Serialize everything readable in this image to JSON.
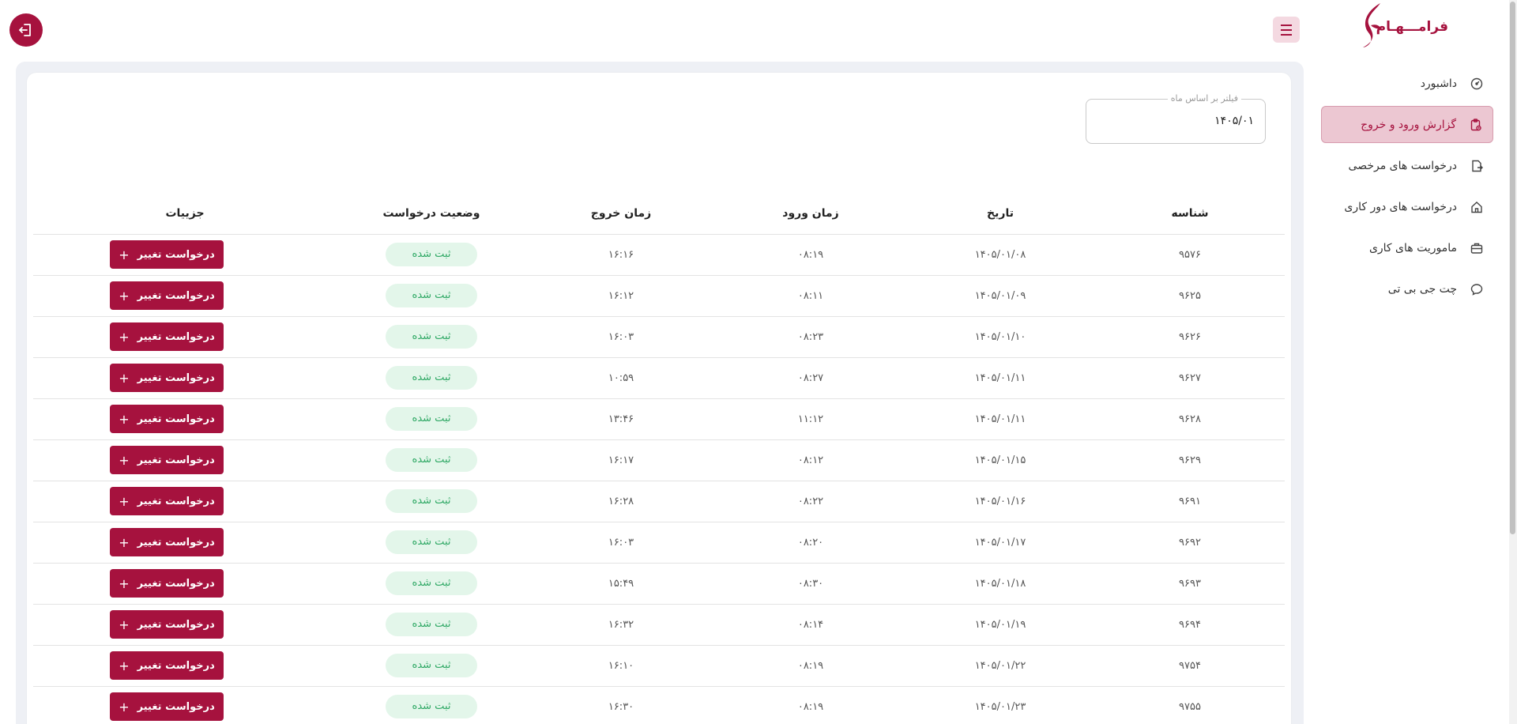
{
  "brand": {
    "logo_text": "فرامـــهـام",
    "accent": "#a6123e"
  },
  "sidebar": {
    "items": [
      {
        "label": "داشبورد",
        "icon": "dashboard-icon"
      },
      {
        "label": "گزارش ورود و خروج",
        "icon": "report-clipboard-icon",
        "active": true
      },
      {
        "label": "درخواست های مرخصی",
        "icon": "leave-request-icon"
      },
      {
        "label": "درخواست های دور کاری",
        "icon": "home-icon"
      },
      {
        "label": "ماموریت های کاری",
        "icon": "briefcase-icon"
      },
      {
        "label": "چت جی بی تی",
        "icon": "chat-icon"
      }
    ]
  },
  "filter": {
    "label": "فیلتر بر اساس ماه",
    "value": "۱۴۰۵/۰۱"
  },
  "table": {
    "headers": {
      "id": "شناسه",
      "date": "تاریخ",
      "in": "زمان ورود",
      "out": "زمان خروج",
      "status": "وضعیت درخواست",
      "details": "جزییات"
    },
    "action_label": "درخواست تغییر",
    "rows": [
      {
        "id": "۹۵۷۶",
        "date": "۱۴۰۵/۰۱/۰۸",
        "in": "۰۸:۱۹",
        "out": "۱۶:۱۶",
        "status": "ثبت شده"
      },
      {
        "id": "۹۶۲۵",
        "date": "۱۴۰۵/۰۱/۰۹",
        "in": "۰۸:۱۱",
        "out": "۱۶:۱۲",
        "status": "ثبت شده"
      },
      {
        "id": "۹۶۲۶",
        "date": "۱۴۰۵/۰۱/۱۰",
        "in": "۰۸:۲۳",
        "out": "۱۶:۰۳",
        "status": "ثبت شده"
      },
      {
        "id": "۹۶۲۷",
        "date": "۱۴۰۵/۰۱/۱۱",
        "in": "۰۸:۲۷",
        "out": "۱۰:۵۹",
        "status": "ثبت شده"
      },
      {
        "id": "۹۶۲۸",
        "date": "۱۴۰۵/۰۱/۱۱",
        "in": "۱۱:۱۲",
        "out": "۱۳:۴۶",
        "status": "ثبت شده"
      },
      {
        "id": "۹۶۲۹",
        "date": "۱۴۰۵/۰۱/۱۵",
        "in": "۰۸:۱۲",
        "out": "۱۶:۱۷",
        "status": "ثبت شده"
      },
      {
        "id": "۹۶۹۱",
        "date": "۱۴۰۵/۰۱/۱۶",
        "in": "۰۸:۲۲",
        "out": "۱۶:۲۸",
        "status": "ثبت شده"
      },
      {
        "id": "۹۶۹۲",
        "date": "۱۴۰۵/۰۱/۱۷",
        "in": "۰۸:۲۰",
        "out": "۱۶:۰۳",
        "status": "ثبت شده"
      },
      {
        "id": "۹۶۹۳",
        "date": "۱۴۰۵/۰۱/۱۸",
        "in": "۰۸:۳۰",
        "out": "۱۵:۴۹",
        "status": "ثبت شده"
      },
      {
        "id": "۹۶۹۴",
        "date": "۱۴۰۵/۰۱/۱۹",
        "in": "۰۸:۱۴",
        "out": "۱۶:۳۲",
        "status": "ثبت شده"
      },
      {
        "id": "۹۷۵۴",
        "date": "۱۴۰۵/۰۱/۲۲",
        "in": "۰۸:۱۹",
        "out": "۱۶:۱۰",
        "status": "ثبت شده"
      },
      {
        "id": "۹۷۵۵",
        "date": "۱۴۰۵/۰۱/۲۳",
        "in": "۰۸:۱۹",
        "out": "۱۶:۳۰",
        "status": "ثبت شده"
      }
    ]
  }
}
